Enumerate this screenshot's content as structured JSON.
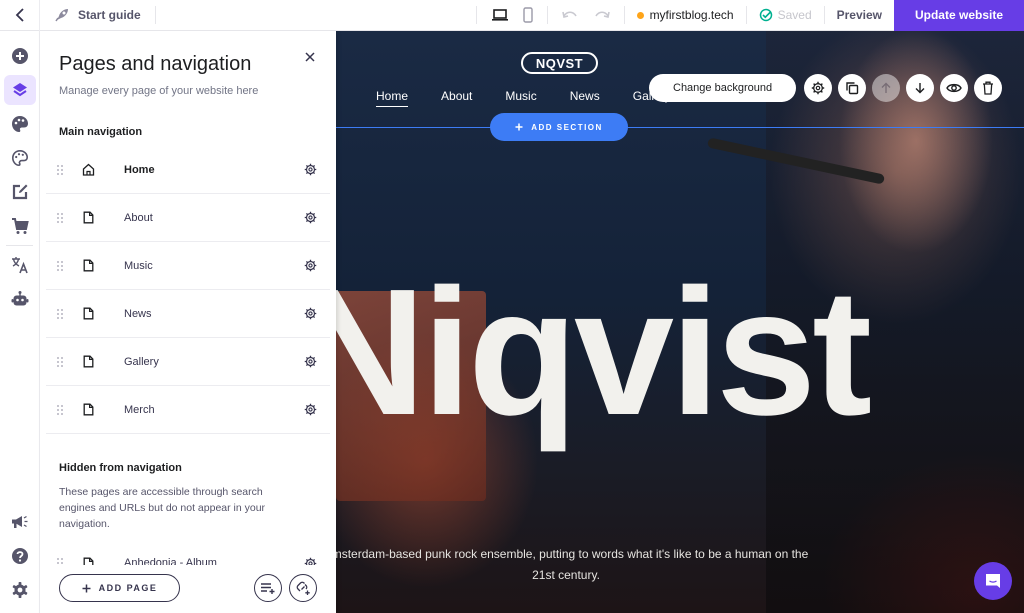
{
  "topbar": {
    "back_icon": "chevron-left-icon",
    "start_guide_label": "Start guide",
    "domain": "myfirstblog.tech",
    "domain_status_color": "#fea419",
    "saved_label": "Saved",
    "preview_label": "Preview",
    "update_label": "Update website",
    "accent_color": "#673de6"
  },
  "rail": {
    "items": [
      {
        "icon": "plus-circle-icon",
        "label": "Add elements"
      },
      {
        "icon": "layers-icon",
        "label": "Pages and navigation",
        "active": true
      },
      {
        "icon": "palette-filled-icon",
        "label": "Website styles"
      },
      {
        "icon": "palette-outline-icon",
        "label": "Templates"
      },
      {
        "icon": "edit-icon",
        "label": "Blog"
      },
      {
        "icon": "cart-icon",
        "label": "Store"
      },
      {
        "icon": "translate-icon",
        "label": "Multilingual"
      },
      {
        "icon": "robot-icon",
        "label": "AI tools"
      }
    ],
    "bottom": [
      {
        "icon": "megaphone-icon",
        "label": "Marketing"
      },
      {
        "icon": "help-icon",
        "label": "Help"
      },
      {
        "icon": "settings-icon",
        "label": "Settings"
      }
    ]
  },
  "panel": {
    "title": "Pages and navigation",
    "subtitle": "Manage every page of your website here",
    "main_nav_heading": "Main navigation",
    "main_pages": [
      {
        "name": "Home",
        "icon": "home-icon"
      },
      {
        "name": "About",
        "icon": "page-icon"
      },
      {
        "name": "Music",
        "icon": "page-icon"
      },
      {
        "name": "News",
        "icon": "page-icon"
      },
      {
        "name": "Gallery",
        "icon": "page-icon"
      },
      {
        "name": "Merch",
        "icon": "page-icon"
      }
    ],
    "hidden_heading": "Hidden from navigation",
    "hidden_description": "These pages are accessible through search engines and URLs but do not appear in your navigation.",
    "hidden_pages": [
      {
        "name": "Anhedonia - Album",
        "icon": "page-icon"
      }
    ],
    "add_page_label": "ADD PAGE"
  },
  "canvas": {
    "logo": "NQVST",
    "nav": [
      "Home",
      "About",
      "Music",
      "News",
      "Gallery"
    ],
    "nav_active": "Home",
    "add_section_label": "ADD SECTION",
    "change_background_label": "Change background",
    "hero_title": "Niqvist",
    "hero_text": "Amsterdam-based punk rock ensemble, putting to words what it's like to be a human on the 21st century.",
    "section_line_color": "#3d7cf5"
  }
}
